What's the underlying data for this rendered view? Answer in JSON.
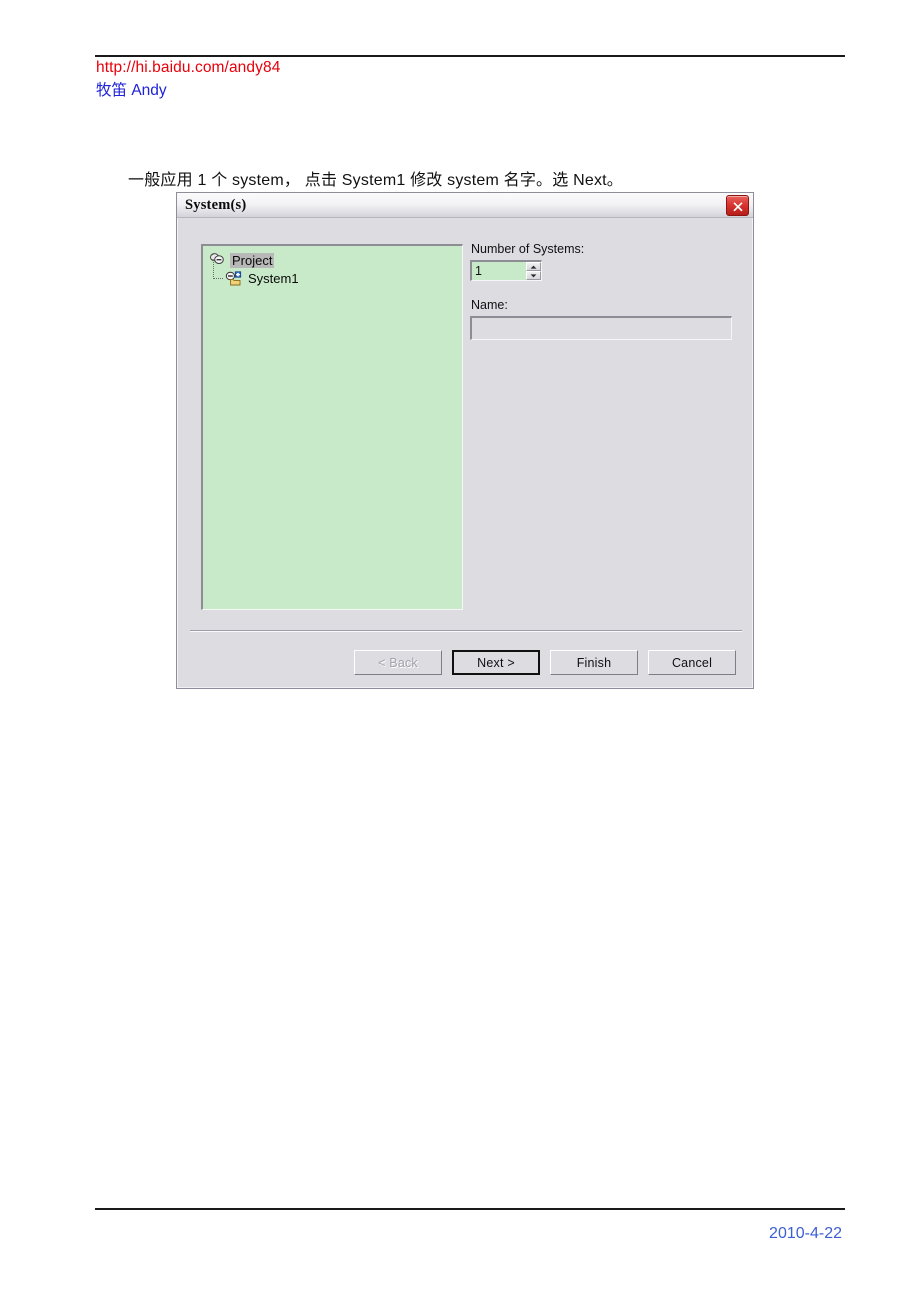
{
  "header": {
    "url": "http://hi.baidu.com/andy84",
    "author_cjk": "牧笛",
    "author_latin": "Andy"
  },
  "footer": {
    "date": "2010-4-22"
  },
  "instruction": {
    "text": "一般应用 1 个 system， 点击 System1 修改 system 名字。选 Next。"
  },
  "dialog": {
    "title": "System(s)",
    "close_glyph": "✕",
    "tree": {
      "nodes": [
        {
          "label": "Project",
          "icon": "project-cylinders-icon",
          "selected": true,
          "level": 0
        },
        {
          "label": "System1",
          "icon": "system-folder-plus-icon",
          "selected": false,
          "level": 1
        }
      ]
    },
    "fields": {
      "number_label": "Number of Systems:",
      "number_value": "1",
      "number_placeholder": "",
      "name_label": "Name:",
      "name_value": "",
      "name_placeholder": ""
    },
    "buttons": [
      {
        "label": "< Back",
        "state": "disabled"
      },
      {
        "label": "Next >",
        "state": "default"
      },
      {
        "label": "Finish",
        "state": "normal"
      },
      {
        "label": "Cancel",
        "state": "normal"
      }
    ]
  },
  "colors": {
    "url_red": "#e8000a",
    "author_blue": "#1f22d8",
    "footer_blue": "#3b5fd0",
    "tree_green": "#c8eac8",
    "dialog_face": "#dcdce1",
    "close_red": "#d8342f"
  }
}
